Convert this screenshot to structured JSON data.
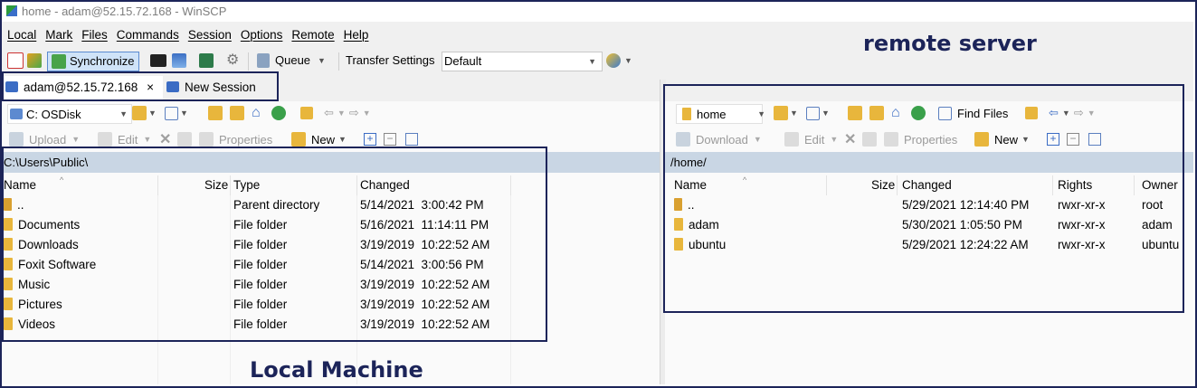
{
  "window": {
    "title": "home - adam@52.15.72.168 - WinSCP"
  },
  "menu": [
    "Local",
    "Mark",
    "Files",
    "Commands",
    "Session",
    "Options",
    "Remote",
    "Help"
  ],
  "toolbar": {
    "synchronize_label": "Synchronize",
    "queue_label": "Queue",
    "transfer_settings_label": "Transfer Settings",
    "transfer_settings_value": "Default"
  },
  "session_tabs": [
    {
      "label": "adam@52.15.72.168",
      "close": "×"
    },
    {
      "label": "New Session"
    }
  ],
  "local": {
    "drive": "C: OSDisk",
    "actions": {
      "upload": "Upload",
      "edit": "Edit",
      "properties": "Properties",
      "new": "New"
    },
    "path": "C:\\Users\\Public\\",
    "columns": [
      "Name",
      "Size",
      "Type",
      "Changed"
    ],
    "rows": [
      {
        "name": "..",
        "size": "",
        "type": "Parent directory",
        "changed": "5/14/2021  3:00:42 PM"
      },
      {
        "name": "Documents",
        "size": "",
        "type": "File folder",
        "changed": "5/16/2021  11:14:11 PM"
      },
      {
        "name": "Downloads",
        "size": "",
        "type": "File folder",
        "changed": "3/19/2019  10:22:52 AM"
      },
      {
        "name": "Foxit Software",
        "size": "",
        "type": "File folder",
        "changed": "5/14/2021  3:00:56 PM"
      },
      {
        "name": "Music",
        "size": "",
        "type": "File folder",
        "changed": "3/19/2019  10:22:52 AM"
      },
      {
        "name": "Pictures",
        "size": "",
        "type": "File folder",
        "changed": "3/19/2019  10:22:52 AM"
      },
      {
        "name": "Videos",
        "size": "",
        "type": "File folder",
        "changed": "3/19/2019  10:22:52 AM"
      }
    ]
  },
  "remote": {
    "drive": "home",
    "find_files_label": "Find Files",
    "actions": {
      "download": "Download",
      "edit": "Edit",
      "properties": "Properties",
      "new": "New"
    },
    "path": "/home/",
    "columns": [
      "Name",
      "Size",
      "Changed",
      "Rights",
      "Owner"
    ],
    "rows": [
      {
        "name": "..",
        "size": "",
        "changed": "5/29/2021 12:14:40 PM",
        "rights": "rwxr-xr-x",
        "owner": "root"
      },
      {
        "name": "adam",
        "size": "",
        "changed": "5/30/2021 1:05:50 PM",
        "rights": "rwxr-xr-x",
        "owner": "adam"
      },
      {
        "name": "ubuntu",
        "size": "",
        "changed": "5/29/2021 12:24:22 AM",
        "rights": "rwxr-xr-x",
        "owner": "ubuntu"
      }
    ]
  },
  "annotations": {
    "remote": "remote server",
    "local": "Local Machine"
  },
  "colors": {
    "annotation": "#1c2459",
    "path_bar": "#c9d6e4",
    "folder": "#e8b63c",
    "sync_highlight": "#cfe3f8"
  }
}
